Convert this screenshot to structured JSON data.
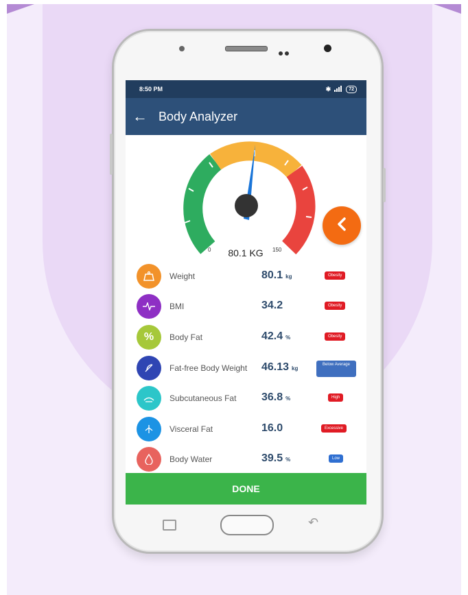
{
  "status_bar": {
    "time": "8:50 PM",
    "signal_text": "✱ .░░l",
    "battery": "72"
  },
  "app_bar": {
    "title": "Body Analyzer",
    "back_icon": "arrow-left-icon"
  },
  "gauge": {
    "min_label": "0",
    "max_label": "150",
    "reading_label": "80.1 KG",
    "value": 80.1,
    "min": 0,
    "max": 150,
    "colors": {
      "green": "#2eac5f",
      "yellow": "#f7b23b",
      "red": "#e9443e",
      "needle": "#1a75d8",
      "hub": "#333333"
    }
  },
  "fab": {
    "icon": "chevron-left-icon",
    "color": "#f36b12"
  },
  "metrics": [
    {
      "label": "Weight",
      "value": "80.1",
      "unit": "kg",
      "status": "Obesity",
      "status_color": "red",
      "icon": "weight-scale-icon",
      "icon_color": "#f2922a"
    },
    {
      "label": "BMI",
      "value": "34.2",
      "unit": "",
      "status": "Obesity",
      "status_color": "red",
      "icon": "heartbeat-icon",
      "icon_color": "#8e2fc4"
    },
    {
      "label": "Body Fat",
      "value": "42.4",
      "unit": "%",
      "status": "Obesity",
      "status_color": "red",
      "icon": "percent-icon",
      "icon_color": "#a6c83a"
    },
    {
      "label": "Fat-free Body Weight",
      "value": "46.13",
      "unit": "kg",
      "status": "Below Average",
      "status_color": "blue",
      "icon": "feather-icon",
      "icon_color": "#2f45b3"
    },
    {
      "label": "Subcutaneous Fat",
      "value": "36.8",
      "unit": "%",
      "status": "High",
      "status_color": "red",
      "icon": "layers-icon",
      "icon_color": "#2cc6c9"
    },
    {
      "label": "Visceral Fat",
      "value": "16.0",
      "unit": "",
      "status": "Excessive",
      "status_color": "red",
      "icon": "organ-icon",
      "icon_color": "#1c93e4"
    },
    {
      "label": "Body Water",
      "value": "39.5",
      "unit": "%",
      "status": "Low",
      "status_color": "blue",
      "icon": "water-drop-icon",
      "icon_color": "#e8635e"
    }
  ],
  "done_button": {
    "label": "DONE",
    "color": "#3bb44a"
  }
}
